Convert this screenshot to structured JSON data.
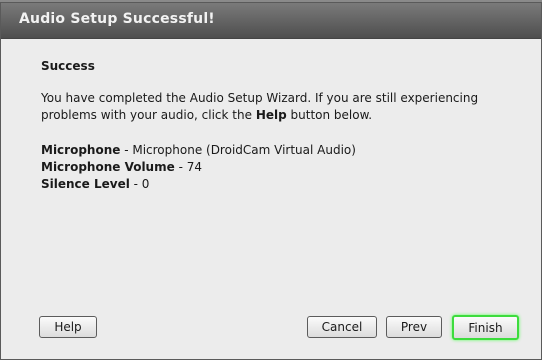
{
  "dialog": {
    "title": "Audio Setup Successful!",
    "heading": "Success",
    "desc_part1": "You have completed the Audio Setup Wizard. If you are still experiencing problems with your audio, click the ",
    "desc_bold": "Help",
    "desc_part2": " button below.",
    "microphone_label": "Microphone",
    "microphone_value": " - Microphone (DroidCam Virtual Audio)",
    "volume_label": "Microphone Volume",
    "volume_value": " - 74",
    "silence_label": "Silence Level",
    "silence_value": " - 0"
  },
  "buttons": {
    "help": "Help",
    "cancel": "Cancel",
    "prev": "Prev",
    "finish": "Finish"
  }
}
